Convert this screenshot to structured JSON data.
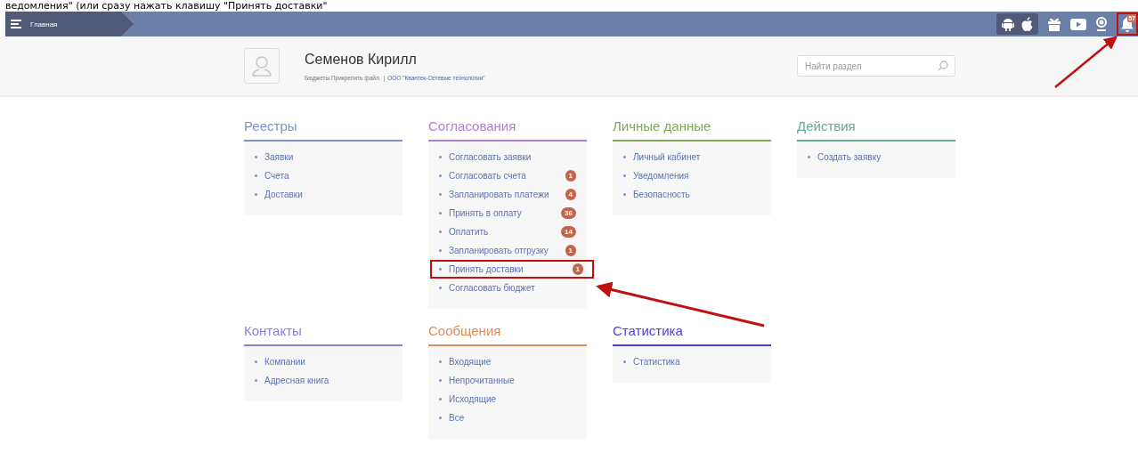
{
  "caption": "ведомления\" (или сразу нажать клавишу \"Принять доставки\"",
  "topbar": {
    "breadcrumb": "Главная",
    "notifications_badge": "57",
    "bell_highlighted": true
  },
  "profile": {
    "name": "Семенов Кирилл",
    "subtitle": "Бюджеты.Прикрепить файл.",
    "separator": "|",
    "company": "ООО \"Квантек-Сетевые технологии\""
  },
  "search": {
    "placeholder": "Найти раздел"
  },
  "sections": [
    {
      "title": "Реестры",
      "color": "#7b93c6",
      "items": [
        {
          "label": "Заявки"
        },
        {
          "label": "Счета"
        },
        {
          "label": "Доставки"
        }
      ]
    },
    {
      "title": "Согласования",
      "color": "#a97fd6",
      "items": [
        {
          "label": "Согласовать заявки"
        },
        {
          "label": "Согласовать счета",
          "badge": "1"
        },
        {
          "label": "Запланировать платежи",
          "badge": "4"
        },
        {
          "label": "Принять в оплату",
          "badge": "36"
        },
        {
          "label": "Оплатить",
          "badge": "14"
        },
        {
          "label": "Запланировать отгрузку",
          "badge": "1"
        },
        {
          "label": "Принять доставки",
          "badge": "1",
          "highlighted": true
        },
        {
          "label": "Согласовать бюджет"
        }
      ]
    },
    {
      "title": "Личные данные",
      "color": "#7fa85a",
      "items": [
        {
          "label": "Личный кабинет"
        },
        {
          "label": "Уведомления"
        },
        {
          "label": "Безопасность"
        }
      ]
    },
    {
      "title": "Действия",
      "color": "#6aa897",
      "items": [
        {
          "label": "Создать заявку"
        }
      ]
    },
    {
      "title": "Контакты",
      "color": "#8a7fe0",
      "items": [
        {
          "label": "Компании"
        },
        {
          "label": "Адресная книга"
        }
      ]
    },
    {
      "title": "Сообщения",
      "color": "#e08c5a",
      "items": [
        {
          "label": "Входящие"
        },
        {
          "label": "Непрочитанные"
        },
        {
          "label": "Исходящие"
        },
        {
          "label": "Все"
        }
      ]
    },
    {
      "title": "Статистика",
      "color": "#4a3fe0",
      "items": [
        {
          "label": "Статистика"
        }
      ]
    }
  ]
}
